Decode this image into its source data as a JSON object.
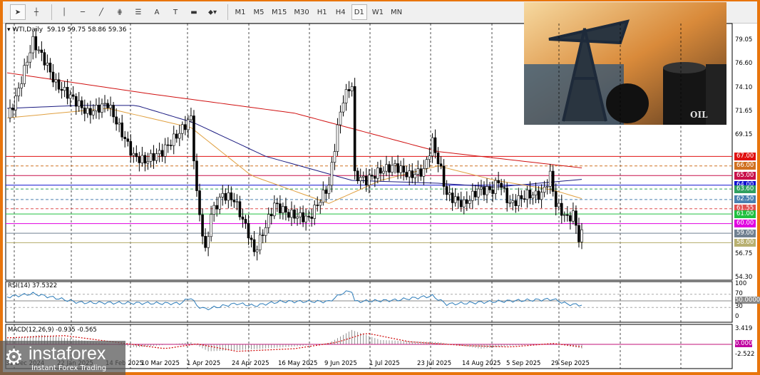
{
  "toolbar": {
    "tools": [
      "cursor-icon",
      "crosshair-icon",
      "vertical-line-icon",
      "horizontal-line-icon",
      "trendline-icon",
      "fibonacci-icon",
      "channel-icon",
      "A",
      "T",
      "rectangle-icon",
      "arrows-icon"
    ],
    "timeframes": [
      "M1",
      "M5",
      "M15",
      "M30",
      "H1",
      "H4",
      "D1",
      "W1",
      "MN"
    ],
    "active": "D1"
  },
  "header": {
    "title": "WTI,Daily",
    "open": "59.19",
    "high": "59.75",
    "low": "58.86",
    "close": "59.36"
  },
  "price_axis": [
    "79.05",
    "76.60",
    "74.10",
    "71.65",
    "69.15",
    "56.75",
    "54.30"
  ],
  "levels": [
    {
      "label": "67.00",
      "color": "#e01010",
      "dashed": false
    },
    {
      "label": "66.00",
      "color": "#d07020",
      "dashed": true
    },
    {
      "label": "65.00",
      "color": "#c8104a",
      "dashed": false
    },
    {
      "label": "64.00",
      "color": "#1010d0",
      "dashed": false
    },
    {
      "label": "63.60",
      "color": "#30a060",
      "dashed": true
    },
    {
      "label": "62.50",
      "color": "#4a80b0",
      "dashed": true
    },
    {
      "label": "61.55",
      "color": "#e05050",
      "dashed": true
    },
    {
      "label": "61.00",
      "color": "#20c040",
      "dashed": false
    },
    {
      "label": "60.00",
      "color": "#e000e0",
      "dashed": false
    },
    {
      "label": "59.00",
      "color": "#708090",
      "dashed": false
    },
    {
      "label": "58.00",
      "color": "#b8b070",
      "dashed": false
    }
  ],
  "rsi": {
    "title": "RSI(14) 37.5322",
    "axis": [
      "100",
      "70",
      "50.0000",
      "30",
      "0"
    ]
  },
  "macd": {
    "title": "MACD(12,26,9) -0.935 -0.565",
    "axis": [
      "3.419",
      "0.000",
      "-2.522"
    ]
  },
  "dates": [
    "31 Dec 2024",
    "22 Jan 2025",
    "14 Feb 2025",
    "10 Mar 2025",
    "1 Apr 2025",
    "24 Apr 2025",
    "16 May 2025",
    "9 Jun 2025",
    "1 Jul 2025",
    "23 Jul 2025",
    "14 Aug 2025",
    "5 Sep 2025",
    "29 Sep 2025"
  ],
  "logo": {
    "name": "instaforex",
    "tagline": "Instant Forex Trading"
  },
  "inset": {
    "text": "OIL"
  },
  "chart_data": {
    "type": "candlestick",
    "symbol": "WTI",
    "timeframe": "Daily",
    "price_path": [
      [
        0,
        71
      ],
      [
        3,
        73
      ],
      [
        9,
        79
      ],
      [
        13,
        77
      ],
      [
        17,
        74.5
      ],
      [
        23,
        73
      ],
      [
        28,
        71.5
      ],
      [
        35,
        72.5
      ],
      [
        39,
        70
      ],
      [
        44,
        67
      ],
      [
        48,
        66.5
      ],
      [
        54,
        67.5
      ],
      [
        60,
        69.5
      ],
      [
        64,
        71
      ],
      [
        66,
        63
      ],
      [
        69,
        57
      ],
      [
        71,
        61
      ],
      [
        75,
        63
      ],
      [
        79,
        62.5
      ],
      [
        84,
        59
      ],
      [
        86,
        57
      ],
      [
        89,
        59
      ],
      [
        93,
        62
      ],
      [
        98,
        61
      ],
      [
        105,
        60.5
      ],
      [
        109,
        62.5
      ],
      [
        112,
        64
      ],
      [
        115,
        70
      ],
      [
        117,
        73
      ],
      [
        120,
        74.5
      ],
      [
        121,
        65
      ],
      [
        125,
        64.5
      ],
      [
        130,
        65.5
      ],
      [
        135,
        66
      ],
      [
        140,
        65
      ],
      [
        145,
        65.5
      ],
      [
        148,
        68.5
      ],
      [
        151,
        65.5
      ],
      [
        153,
        63
      ],
      [
        159,
        62
      ],
      [
        164,
        63.5
      ],
      [
        169,
        63.5
      ],
      [
        171,
        64.5
      ],
      [
        175,
        62
      ],
      [
        181,
        63
      ],
      [
        186,
        63
      ],
      [
        189,
        65
      ],
      [
        191,
        62
      ],
      [
        195,
        60.5
      ],
      [
        197,
        61
      ],
      [
        199,
        58.5
      ],
      [
        200,
        59.36
      ]
    ],
    "ma_red": [
      [
        0,
        75.7
      ],
      [
        50,
        73.5
      ],
      [
        100,
        71.5
      ],
      [
        150,
        67.5
      ],
      [
        200,
        65.8
      ]
    ],
    "ma_blue": [
      [
        0,
        72
      ],
      [
        25,
        72.3
      ],
      [
        45,
        72.3
      ],
      [
        65,
        70.5
      ],
      [
        90,
        67
      ],
      [
        120,
        64.5
      ],
      [
        150,
        64.2
      ],
      [
        170,
        63.8
      ],
      [
        200,
        64.6
      ]
    ],
    "ma_orange": [
      [
        0,
        71
      ],
      [
        35,
        72
      ],
      [
        64,
        70
      ],
      [
        85,
        65
      ],
      [
        112,
        62.1
      ],
      [
        130,
        64.5
      ],
      [
        150,
        66
      ],
      [
        170,
        64.5
      ],
      [
        190,
        63.5
      ],
      [
        200,
        62.6
      ]
    ],
    "rsi": [
      [
        0,
        62
      ],
      [
        9,
        72
      ],
      [
        25,
        45
      ],
      [
        60,
        42
      ],
      [
        64,
        60
      ],
      [
        66,
        35
      ],
      [
        69,
        25
      ],
      [
        80,
        42
      ],
      [
        86,
        35
      ],
      [
        95,
        48
      ],
      [
        112,
        48
      ],
      [
        117,
        75
      ],
      [
        120,
        80
      ],
      [
        121,
        48
      ],
      [
        135,
        52
      ],
      [
        148,
        65
      ],
      [
        153,
        40
      ],
      [
        170,
        48
      ],
      [
        190,
        55
      ],
      [
        195,
        40
      ],
      [
        200,
        37.5
      ]
    ],
    "macd": [
      [
        0,
        1.2
      ],
      [
        12,
        2.2
      ],
      [
        30,
        0.6
      ],
      [
        45,
        -0.7
      ],
      [
        60,
        0.2
      ],
      [
        64,
        0.5
      ],
      [
        70,
        -1.6
      ],
      [
        84,
        -1.2
      ],
      [
        100,
        -0.5
      ],
      [
        112,
        0.3
      ],
      [
        120,
        3.3
      ],
      [
        130,
        1.0
      ],
      [
        150,
        0.5
      ],
      [
        165,
        -1.0
      ],
      [
        175,
        -0.3
      ],
      [
        190,
        0.2
      ],
      [
        200,
        -0.935
      ]
    ],
    "macd_signal": [
      [
        0,
        1.5
      ],
      [
        20,
        2.0
      ],
      [
        40,
        0.3
      ],
      [
        55,
        -1.0
      ],
      [
        66,
        0.1
      ],
      [
        80,
        -1.6
      ],
      [
        100,
        -1.0
      ],
      [
        115,
        0.5
      ],
      [
        125,
        2.6
      ],
      [
        140,
        0.6
      ],
      [
        160,
        -0.3
      ],
      [
        175,
        -0.6
      ],
      [
        190,
        0.2
      ],
      [
        200,
        -0.565
      ]
    ]
  }
}
